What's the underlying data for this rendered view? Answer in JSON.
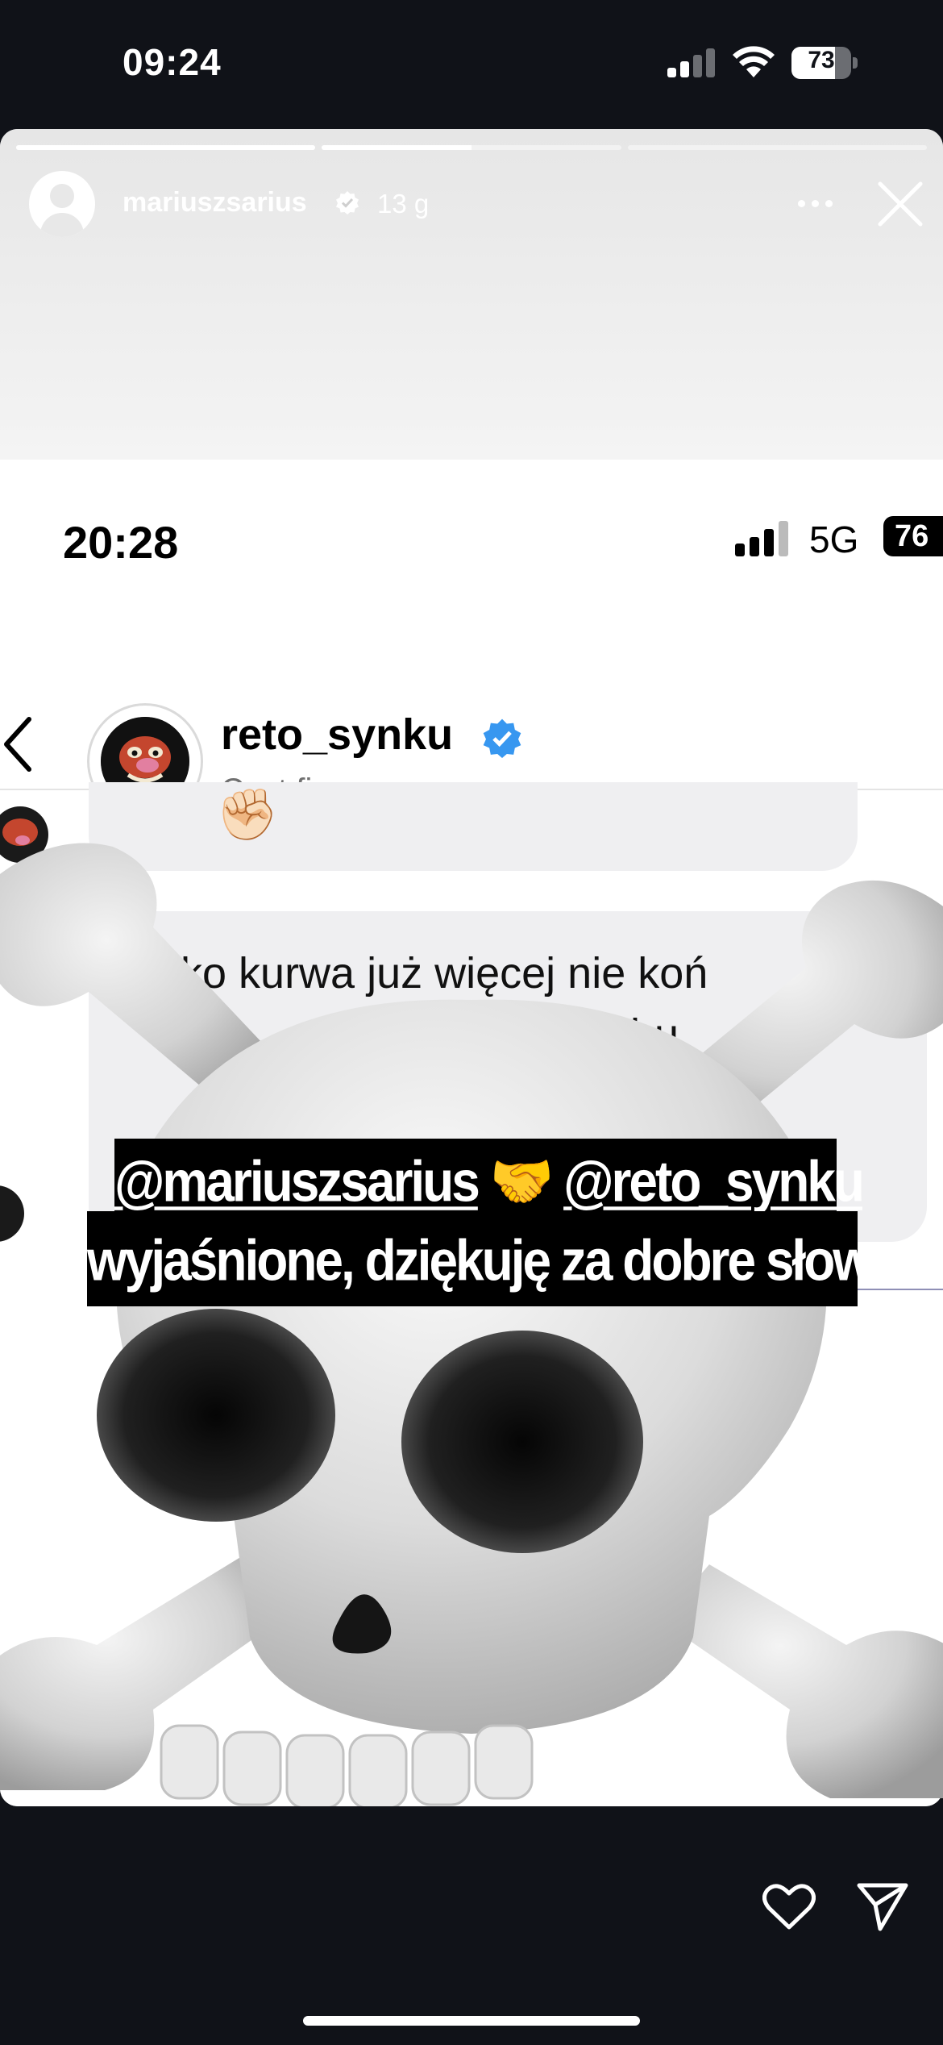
{
  "device_status": {
    "time": "09:24",
    "battery": "73",
    "battery_level": 0.73,
    "icons": [
      "signal-icon",
      "wifi-icon",
      "battery-icon"
    ]
  },
  "story": {
    "progress_segments": [
      1.0,
      0.5,
      0.0
    ],
    "username": "mariuszsarius",
    "age": "13 g",
    "icons": [
      "more-icon",
      "close-icon",
      "verified-icon"
    ]
  },
  "inner_screenshot": {
    "time": "20:28",
    "network": "5G",
    "battery": "76",
    "chat": {
      "name": "reto_synku",
      "subtitle": "Czat firmowy",
      "messages": [
        {
          "text": "✊🏻"
        },
        {
          "lines": [
            "lko kurwa już więcej nie koń",
            "trzebu"
          ]
        }
      ]
    }
  },
  "caption": {
    "line1_mention_a": "@mariuszsarius",
    "line1_emoji": "🤝",
    "line1_mention_b": "@reto_synku",
    "line2": "wyjaśnione, dziękuję za dobre słowa l."
  },
  "actions": {
    "icons": [
      "heart-icon",
      "send-icon"
    ]
  },
  "colors": {
    "background": "#101218",
    "verified_blue": "#3797f0",
    "caption_bg": "#000000"
  }
}
